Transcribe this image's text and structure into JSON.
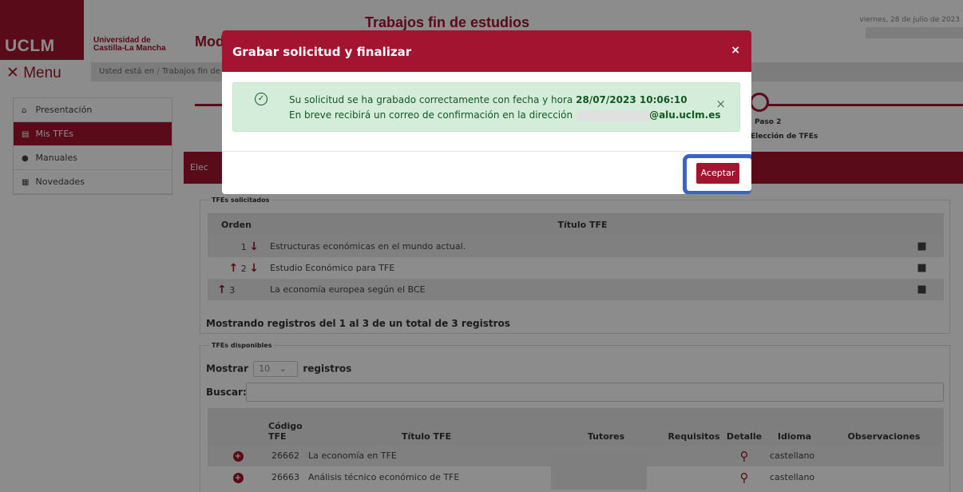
{
  "header": {
    "app_title": "Trabajos fin de estudios",
    "module_partial": "Mod",
    "logo": "UCLM",
    "university_line1": "Universidad de",
    "university_line2": "Castilla-La Mancha",
    "date": "viernes, 28 de julio de 2023"
  },
  "menubar": {
    "menu_label": "Menu",
    "breadcrumb_prefix": "Usted está en",
    "breadcrumb_sep": "/",
    "breadcrumb_item": "Trabajos fin de e"
  },
  "sidebar": {
    "items": [
      {
        "label": "Presentación",
        "icon": "home-icon"
      },
      {
        "label": "Mis TFEs",
        "icon": "document-icon"
      },
      {
        "label": "Manuales",
        "icon": "info-icon"
      },
      {
        "label": "Novedades",
        "icon": "newspaper-icon"
      }
    ]
  },
  "steps": {
    "step2_label": "Paso 2",
    "step2_sub": "Elección de TFEs"
  },
  "panel": {
    "title_partial": "Elec"
  },
  "requested": {
    "legend": "TFEs solicitados",
    "columns": [
      "Orden",
      "Título TFE"
    ],
    "rows": [
      {
        "order": "1",
        "title": "Estructuras económicas en el mundo actual."
      },
      {
        "order": "2",
        "title": "Estudio Económico para TFE"
      },
      {
        "order": "3",
        "title": "La economía europea según el BCE"
      }
    ],
    "showing": "Mostrando registros del 1 al 3 de un total de 3 registros"
  },
  "available": {
    "legend": "TFEs disponibles",
    "show_label": "Mostrar",
    "show_value": "10",
    "records_label": "registros",
    "search_label": "Buscar:",
    "columns": [
      "Código TFE",
      "Título TFE",
      "Tutores",
      "Requisitos",
      "Detalle",
      "Idioma",
      "Observaciones"
    ],
    "rows": [
      {
        "code": "26662",
        "title": "La economía en TFE",
        "language": "castellano"
      },
      {
        "code": "26663",
        "title": "Análisis técnico económico de TFE",
        "language": "castellano"
      }
    ]
  },
  "modal": {
    "title": "Grabar solicitud y finalizar",
    "close": "×",
    "message_prefix": "Su solicitud se ha grabado correctamente con fecha y hora",
    "datetime": "28/07/2023 10:06:10",
    "message_line2": "En breve recibirá un correo de confirmación en la dirección",
    "email_suffix": "@alu.uclm.es",
    "alert_close": "×",
    "accept_label": "Aceptar"
  },
  "colors": {
    "brand": "#a2142f",
    "success_bg": "#d4edda",
    "highlight": "#3b64c8"
  }
}
